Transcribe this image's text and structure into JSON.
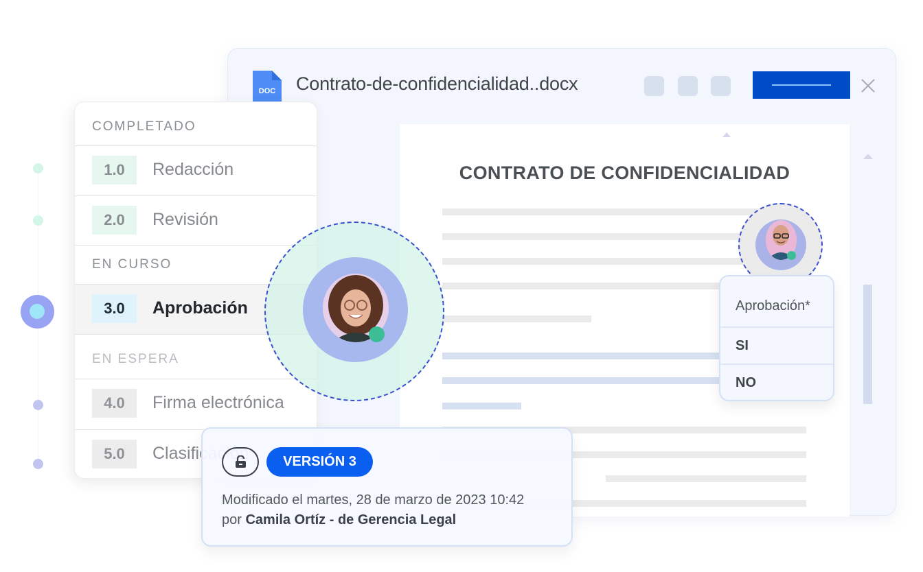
{
  "document": {
    "file_type_badge": "DOC",
    "file_name": "Contrato-de-confidencialidad..docx",
    "heading": "CONTRATO DE CONFIDENCIALIDAD"
  },
  "colors": {
    "primary": "#004bc8",
    "badge_blue": "#0b5ff0",
    "online_green": "#3dbd95",
    "dashed_ring": "#3a4fd0",
    "done_step_bg": "#e6f7ef",
    "active_step_bg": "#dff3fd"
  },
  "workflow": {
    "sections": [
      {
        "label": "COMPLETADO",
        "status": "completed",
        "steps": [
          {
            "number": "1.0",
            "label": "Redacción"
          },
          {
            "number": "2.0",
            "label": "Revisión"
          }
        ]
      },
      {
        "label": "EN CURSO",
        "status": "in-progress",
        "steps": [
          {
            "number": "3.0",
            "label": "Aprobación"
          }
        ]
      },
      {
        "label": "EN ESPERA",
        "status": "waiting",
        "steps": [
          {
            "number": "4.0",
            "label": "Firma electrónica"
          },
          {
            "number": "5.0",
            "label": "Clasificación"
          }
        ]
      }
    ]
  },
  "approval": {
    "label": "Aprobación*",
    "options": [
      "SI",
      "NO"
    ]
  },
  "version": {
    "badge": "VERSIÓN 3",
    "lock_icon": "unlocked-padlock",
    "modified_text": "Modificado el martes, 28 de marzo de 2023 10:42",
    "by_prefix": "por",
    "author": "Camila Ortíz - de Gerencia Legal"
  }
}
